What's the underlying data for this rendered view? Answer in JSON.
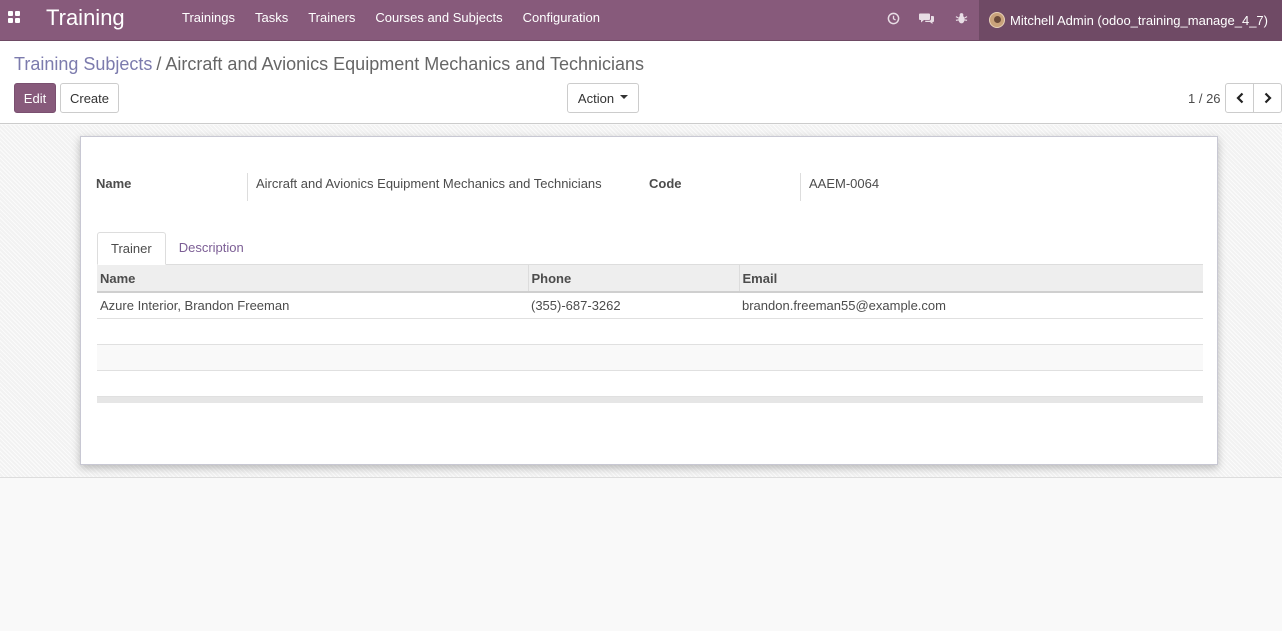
{
  "navbar": {
    "brand": "Training",
    "menu": [
      "Trainings",
      "Tasks",
      "Trainers",
      "Courses and Subjects",
      "Configuration"
    ],
    "systray_icons": [
      "clock-icon",
      "chat-icon",
      "bug-icon"
    ],
    "user": "Mitchell Admin (odoo_training_manage_4_7)"
  },
  "breadcrumb": {
    "parent": "Training Subjects",
    "separator": "/",
    "current": "Aircraft and Avionics Equipment Mechanics and Technicians"
  },
  "buttons": {
    "edit": "Edit",
    "create": "Create",
    "action": "Action"
  },
  "pager": {
    "value": "1 / 26"
  },
  "form": {
    "name_label": "Name",
    "name_value": "Aircraft and Avionics Equipment Mechanics and Technicians",
    "code_label": "Code",
    "code_value": "AAEM-0064"
  },
  "tabs": [
    "Trainer",
    "Description"
  ],
  "trainer_table": {
    "columns": [
      "Name",
      "Phone",
      "Email"
    ],
    "rows": [
      {
        "name": "Azure Interior, Brandon Freeman",
        "phone": "(355)-687-3262",
        "email": "brandon.freeman55@example.com"
      }
    ]
  },
  "colors": {
    "brand": "#875a7b",
    "user_menu": "#6f4a65",
    "link": "#7c7bad"
  }
}
